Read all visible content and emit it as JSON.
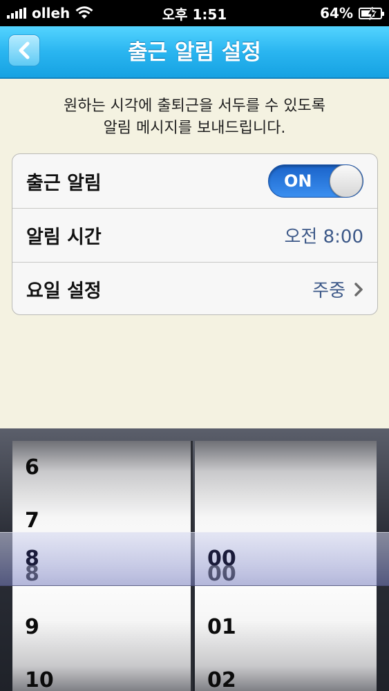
{
  "status_bar": {
    "carrier": "olleh",
    "time": "오후 1:51",
    "battery": "64%"
  },
  "nav": {
    "title": "출근 알림 설정",
    "back_icon": "chevron-left-icon"
  },
  "description": {
    "line1": "원하는 시각에 출퇴근을 서두를 수 있도록",
    "line2": "알림 메시지를 보내드립니다."
  },
  "settings": {
    "alarm_label": "출근 알림",
    "toggle_label": "ON",
    "time_label": "알림 시간",
    "time_value": "오전 8:00",
    "days_label": "요일 설정",
    "days_value": "주중"
  },
  "picker": {
    "hours": [
      "6",
      "7",
      "8",
      "9",
      "10"
    ],
    "minutes": [
      "",
      "",
      "00",
      "01",
      "02"
    ],
    "selected_hour": "8",
    "selected_minute": "00"
  },
  "colors": {
    "nav_blue": "#2ab5f0",
    "toggle_blue": "#2a79e0",
    "value_blue": "#3c5888",
    "background": "#f4f2e1"
  }
}
